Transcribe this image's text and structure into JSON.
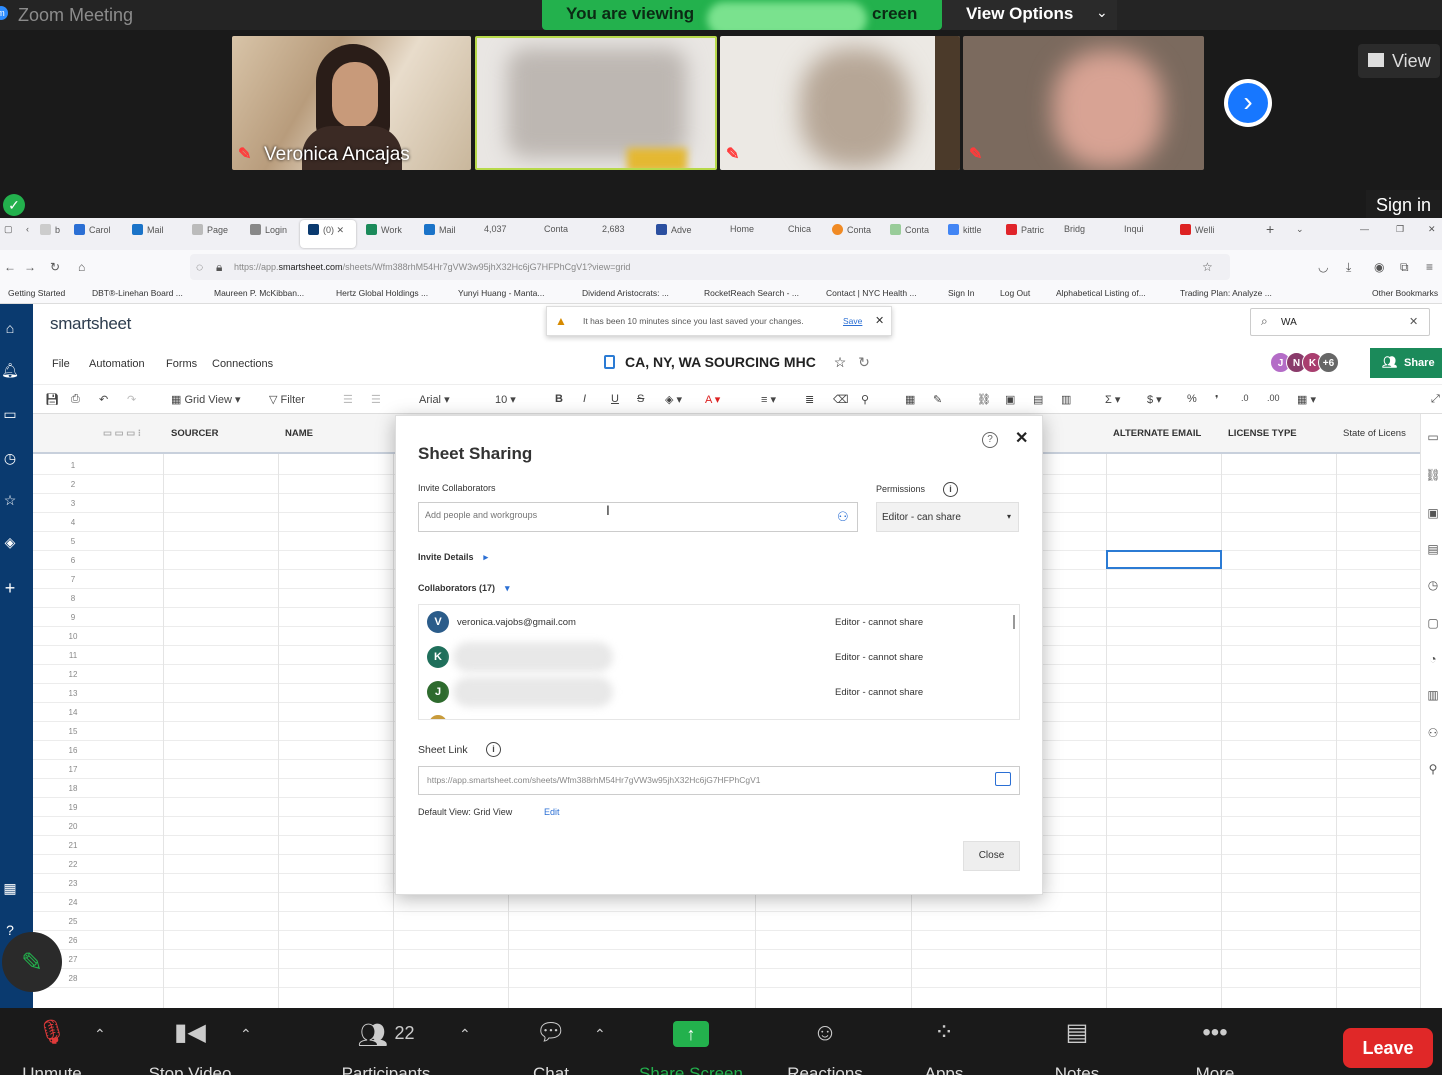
{
  "zoom": {
    "window_title": "Zoom Meeting",
    "viewing_banner_prefix": "You are viewing",
    "viewing_banner_suffix": "creen",
    "view_options": "View Options",
    "view_button": "View",
    "sign_in": "Sign in",
    "participant_name": "Veronica Ancajas",
    "toolbar": {
      "unmute": "Unmute",
      "stop_video": "Stop Video",
      "participants": "Participants",
      "participants_count": "22",
      "chat": "Chat",
      "share_screen": "Share Screen",
      "reactions": "Reactions",
      "apps": "Apps",
      "notes": "Notes",
      "more": "More",
      "leave": "Leave"
    },
    "accent_green": "#23b14d",
    "leave_red": "#e02828"
  },
  "browser": {
    "tabs": [
      "b",
      "Carol",
      "Mail",
      "Page",
      "Login",
      "(0)",
      "Work",
      "Mail",
      "4,037",
      "Conta",
      "2,683",
      "Adve",
      "Home",
      "Chica",
      "Conta",
      "Conta",
      "kittle",
      "Patric",
      "Bridg",
      "Inqui",
      "Welli"
    ],
    "url_prefix": "https://app.",
    "url_domain": "smartsheet.com",
    "url_rest": "/sheets/Wfm388rhM54Hr7gVW3w95jhX32Hc6jG7HFPhCgV1?view=grid",
    "bookmarks": [
      "Getting Started",
      "DBT®-Linehan Board ...",
      "Maureen P. McKibban...",
      "Hertz Global Holdings ...",
      "Yunyi Huang - Manta...",
      "Dividend Aristocrats: ...",
      "RocketReach Search - ...",
      "Contact | NYC Health ...",
      "Sign In",
      "Log Out",
      "Alphabetical Listing of...",
      "Trading Plan: Analyze ...",
      "Other Bookmarks"
    ]
  },
  "smartsheet": {
    "logo": "smartsheet",
    "menu": [
      "File",
      "Automation",
      "Forms",
      "Connections"
    ],
    "save_notice": "It has been 10 minutes since you last saved your changes.",
    "save_link": "Save",
    "search_value": "WA",
    "sheet_title": "CA, NY, WA SOURCING MHC",
    "avatars": [
      "J",
      "N",
      "K"
    ],
    "avatar_more": "+6",
    "share": "Share",
    "toolbar": {
      "view": "Grid View",
      "filter": "Filter",
      "font": "Arial",
      "size": "10"
    },
    "columns": [
      "SOURCER",
      "NAME",
      "ALTERNATE EMAIL",
      "LICENSE TYPE",
      "State of Licens"
    ],
    "rows": [
      "1",
      "2",
      "3",
      "4",
      "5",
      "6",
      "7",
      "8",
      "9",
      "10",
      "11",
      "12",
      "13",
      "14",
      "15",
      "16",
      "17",
      "18",
      "19",
      "20",
      "21",
      "22",
      "23",
      "24",
      "25",
      "26",
      "27",
      "28"
    ]
  },
  "modal": {
    "title": "Sheet Sharing",
    "invite_label": "Invite Collaborators",
    "invite_placeholder": "Add people and workgroups",
    "permissions_label": "Permissions",
    "permission_value": "Editor - can share",
    "invite_details": "Invite Details",
    "collaborators_label": "Collaborators (17)",
    "collaborators": [
      {
        "initial": "V",
        "email": "veronica.vajobs@gmail.com",
        "role": "Editor - cannot share",
        "color": "#2b5c8a"
      },
      {
        "initial": "K",
        "email": "",
        "role": "Editor - cannot share",
        "color": "#1f6f5b"
      },
      {
        "initial": "J",
        "email": "",
        "role": "Editor - cannot share",
        "color": "#2e6b2e"
      }
    ],
    "sheet_link_label": "Sheet Link",
    "sheet_link": "https://app.smartsheet.com/sheets/Wfm388rhM54Hr7gVW3w95jhX32Hc6jG7HFPhCgV1",
    "default_view": "Default View: Grid View",
    "edit": "Edit",
    "close": "Close"
  }
}
